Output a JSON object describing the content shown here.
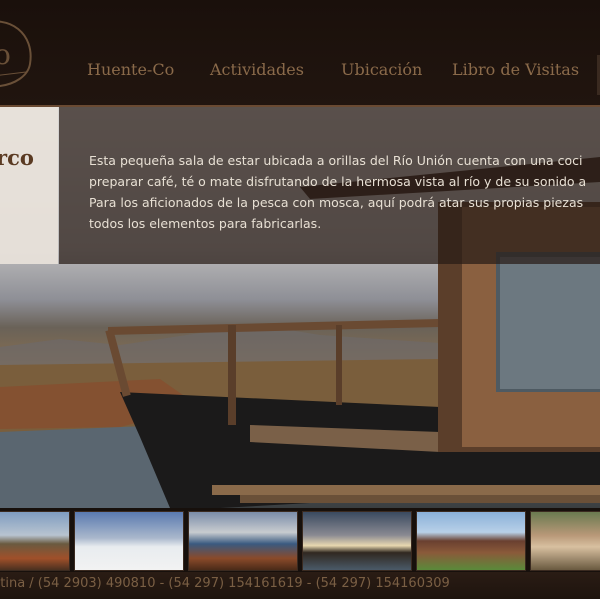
{
  "nav": {
    "items": [
      {
        "label": "Huente-Co"
      },
      {
        "label": "Actividades"
      },
      {
        "label": "Ubicación"
      },
      {
        "label": "Libro de Visitas"
      }
    ]
  },
  "logo": {
    "text": "o"
  },
  "section": {
    "title": "rco",
    "description_lines": [
      "Esta pequeña sala de estar ubicada a orillas del Río Unión cuenta con una coci",
      "preparar café, té o mate disfrutando de la hermosa vista al río y de su sonido a",
      "Para los aficionados de la pesca con mosca, aquí podrá atar sus propias piezas",
      "todos los elementos para fabricarlas."
    ]
  },
  "footer": {
    "contact": "ntina / (54 2903) 490810 - (54 297) 154161619 - (54 297) 154160309"
  },
  "colors": {
    "header_bg": "#1a100b",
    "nav_text": "#8a6a4a",
    "overlay_bg": "#281c16",
    "overlay_text": "#e8e0d4",
    "title_text": "#5a3a22",
    "footer_text": "#7a5f44"
  }
}
